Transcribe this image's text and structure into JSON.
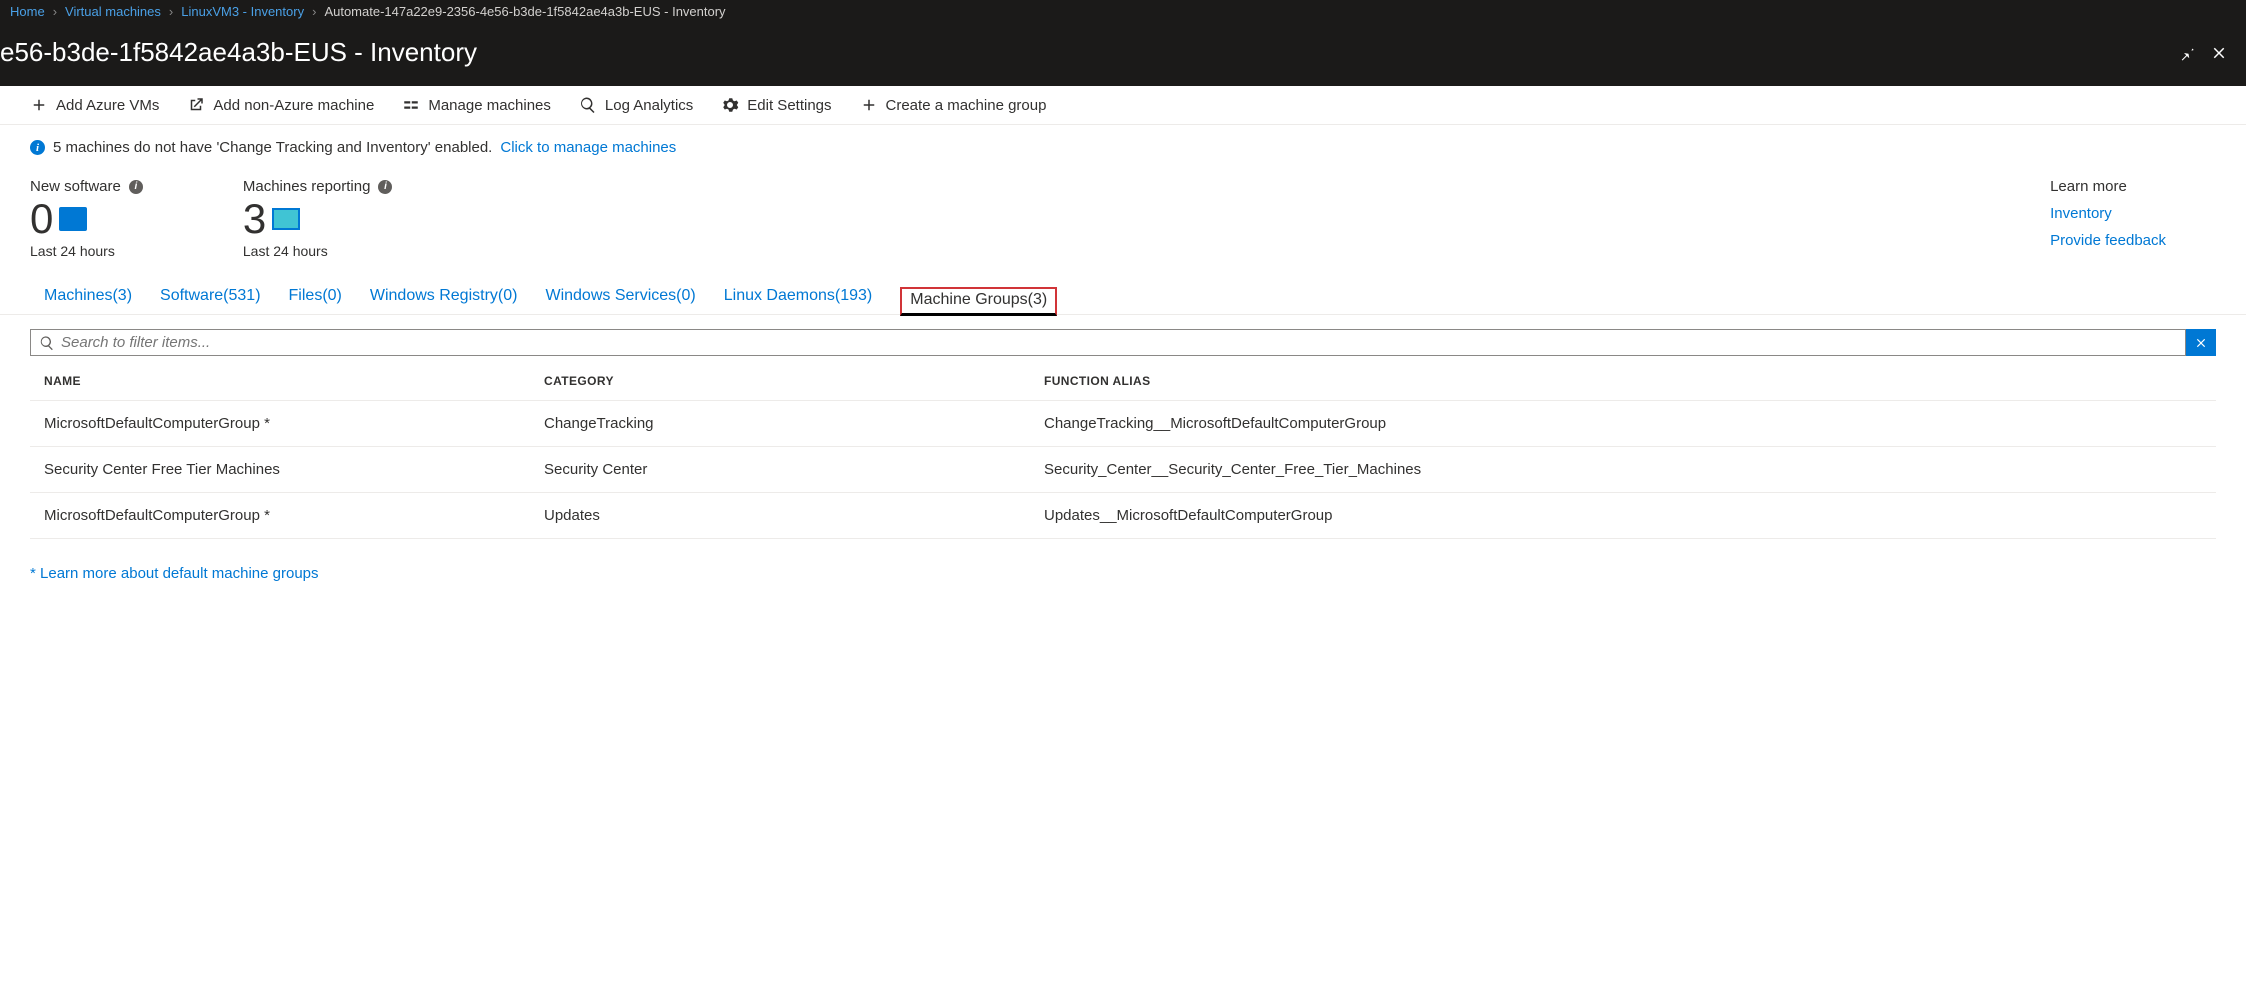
{
  "breadcrumb": {
    "items": [
      "Home",
      "Virtual machines",
      "LinuxVM3 - Inventory",
      "Automate-147a22e9-2356-4e56-b3de-1f5842ae4a3b-EUS - Inventory"
    ]
  },
  "header": {
    "title": "e56-b3de-1f5842ae4a3b-EUS - Inventory"
  },
  "toolbar": {
    "add_azure": "Add Azure VMs",
    "add_non_azure": "Add non-Azure machine",
    "manage_machines": "Manage machines",
    "log_analytics": "Log Analytics",
    "edit_settings": "Edit Settings",
    "create_group": "Create a machine group"
  },
  "banner": {
    "text": "5 machines do not have 'Change Tracking and Inventory' enabled. ",
    "link": "Click to manage machines"
  },
  "stats": {
    "new_software": {
      "label": "New software",
      "value": "0",
      "sub": "Last 24 hours"
    },
    "machines_reporting": {
      "label": "Machines reporting",
      "value": "3",
      "sub": "Last 24 hours"
    }
  },
  "learn": {
    "title": "Learn more",
    "inventory": "Inventory",
    "feedback": "Provide feedback"
  },
  "tabs": {
    "machines": "Machines(3)",
    "software": "Software(531)",
    "files": "Files(0)",
    "registry": "Windows Registry(0)",
    "services": "Windows Services(0)",
    "daemons": "Linux Daemons(193)",
    "groups": "Machine Groups(3)"
  },
  "search": {
    "placeholder": "Search to filter items..."
  },
  "table": {
    "headers": {
      "name": "NAME",
      "category": "CATEGORY",
      "alias": "FUNCTION ALIAS"
    },
    "rows": [
      {
        "name": "MicrosoftDefaultComputerGroup *",
        "category": "ChangeTracking",
        "alias": "ChangeTracking__MicrosoftDefaultComputerGroup"
      },
      {
        "name": "Security Center Free Tier Machines",
        "category": "Security Center",
        "alias": "Security_Center__Security_Center_Free_Tier_Machines"
      },
      {
        "name": "MicrosoftDefaultComputerGroup *",
        "category": "Updates",
        "alias": "Updates__MicrosoftDefaultComputerGroup"
      }
    ]
  },
  "footer": {
    "link": "* Learn more about default machine groups"
  }
}
